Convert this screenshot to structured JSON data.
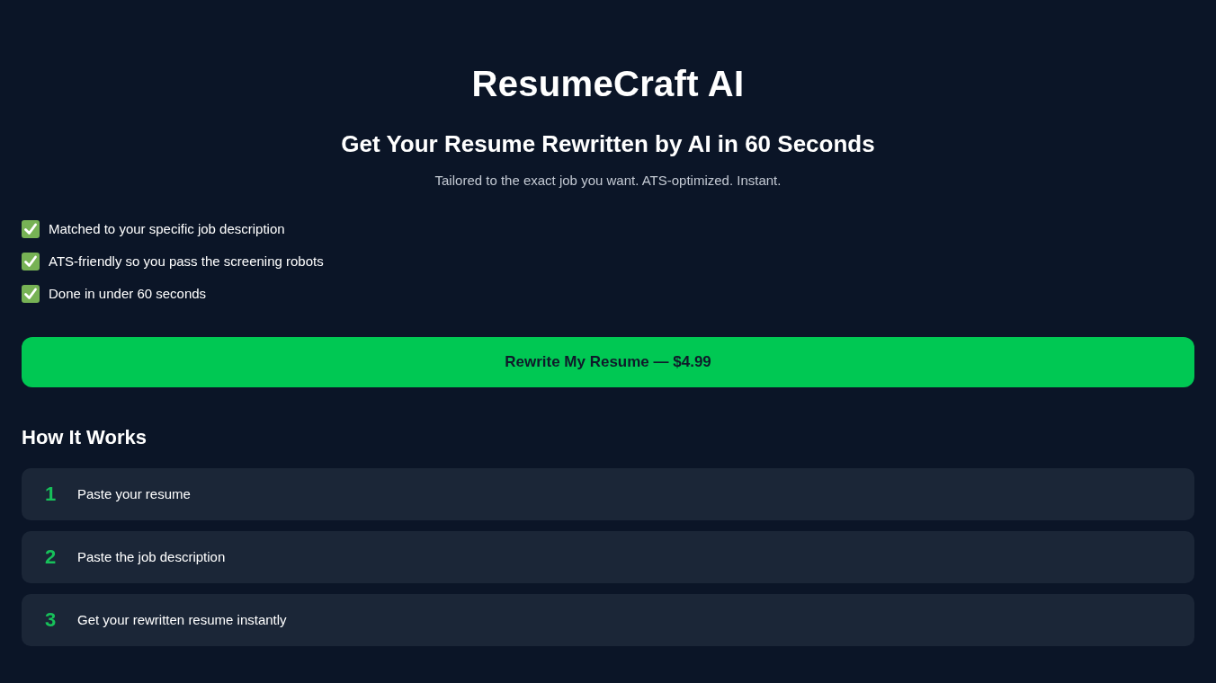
{
  "header": {
    "title": "ResumeCraft AI",
    "headline": "Get Your Resume Rewritten by AI in 60 Seconds",
    "tagline": "Tailored to the exact job you want. ATS-optimized. Instant."
  },
  "features": [
    "Matched to your specific job description",
    "ATS-friendly so you pass the screening robots",
    "Done in under 60 seconds"
  ],
  "cta_button": {
    "label": "Rewrite My Resume — $4.99"
  },
  "how_it_works": {
    "heading": "How It Works",
    "steps": [
      {
        "number": "1",
        "text": "Paste your resume"
      },
      {
        "number": "2",
        "text": "Paste the job description"
      },
      {
        "number": "3",
        "text": "Get your rewritten resume instantly"
      }
    ]
  }
}
